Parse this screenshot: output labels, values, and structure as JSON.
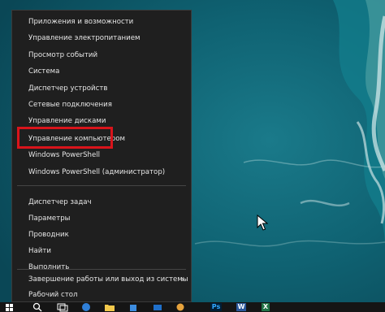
{
  "context_menu": {
    "items": [
      {
        "label": "Приложения и возможности"
      },
      {
        "label": "Управление электропитанием"
      },
      {
        "label": "Просмотр событий"
      },
      {
        "label": "Система"
      },
      {
        "label": "Диспетчер устройств"
      },
      {
        "label": "Сетевые подключения"
      },
      {
        "label": "Управление дисками"
      },
      {
        "label": "Управление компьютером",
        "highlighted": true
      },
      {
        "label": "Windows PowerShell"
      },
      {
        "label": "Windows PowerShell (администратор)"
      },
      {
        "label": "Диспетчер задач"
      },
      {
        "label": "Параметры"
      },
      {
        "label": "Проводник"
      },
      {
        "label": "Найти"
      },
      {
        "label": "Выполнить"
      },
      {
        "label": "Завершение работы или выход из системы",
        "has_submenu": true
      },
      {
        "label": "Рабочий стол"
      }
    ],
    "colors": {
      "background": "#1f1f1f",
      "text": "#e6e6e6",
      "highlight_border": "#d9141b"
    }
  },
  "taskbar": {
    "apps": [
      {
        "name": "photoshop",
        "glyph": "Ps",
        "color": "#31a8ff"
      },
      {
        "name": "word",
        "glyph": "W",
        "color": "#2b579a"
      },
      {
        "name": "excel",
        "glyph": "X",
        "color": "#217346"
      }
    ]
  }
}
